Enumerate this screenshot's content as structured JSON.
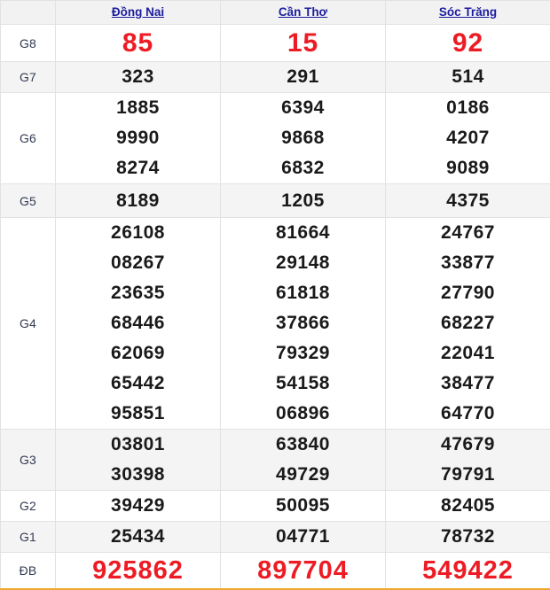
{
  "table": {
    "label_column_header": "",
    "provinces": [
      {
        "name": "Đồng Nai",
        "icon": "link-text"
      },
      {
        "name": "Cần Thơ",
        "icon": "link-text"
      },
      {
        "name": "Sóc Trăng",
        "icon": "link-text"
      }
    ],
    "colors": {
      "link": "#1c1ca0",
      "highlight_red": "#ed1b24",
      "number_black": "#1a1a1a",
      "row_shade": "#f4f4f4",
      "header_bg": "#f2f2f2",
      "border": "#e2e2e2",
      "bottom_accent": "#f0a62a"
    },
    "rows": [
      {
        "prize": "G8",
        "style": "red-big",
        "shaded": false,
        "cells": [
          [
            "85"
          ],
          [
            "15"
          ],
          [
            "92"
          ]
        ]
      },
      {
        "prize": "G7",
        "style": "normal",
        "shaded": true,
        "cells": [
          [
            "323"
          ],
          [
            "291"
          ],
          [
            "514"
          ]
        ]
      },
      {
        "prize": "G6",
        "style": "normal",
        "shaded": false,
        "cells": [
          [
            "1885",
            "9990",
            "8274"
          ],
          [
            "6394",
            "9868",
            "6832"
          ],
          [
            "0186",
            "4207",
            "9089"
          ]
        ]
      },
      {
        "prize": "G5",
        "style": "normal",
        "shaded": true,
        "cells": [
          [
            "8189"
          ],
          [
            "1205"
          ],
          [
            "4375"
          ]
        ]
      },
      {
        "prize": "G4",
        "style": "normal",
        "shaded": false,
        "cells": [
          [
            "26108",
            "08267",
            "23635",
            "68446",
            "62069",
            "65442",
            "95851"
          ],
          [
            "81664",
            "29148",
            "61818",
            "37866",
            "79329",
            "54158",
            "06896"
          ],
          [
            "24767",
            "33877",
            "27790",
            "68227",
            "22041",
            "38477",
            "64770"
          ]
        ]
      },
      {
        "prize": "G3",
        "style": "normal",
        "shaded": true,
        "cells": [
          [
            "03801",
            "30398"
          ],
          [
            "63840",
            "49729"
          ],
          [
            "47679",
            "79791"
          ]
        ]
      },
      {
        "prize": "G2",
        "style": "normal",
        "shaded": false,
        "cells": [
          [
            "39429"
          ],
          [
            "50095"
          ],
          [
            "82405"
          ]
        ]
      },
      {
        "prize": "G1",
        "style": "normal",
        "shaded": true,
        "cells": [
          [
            "25434"
          ],
          [
            "04771"
          ],
          [
            "78732"
          ]
        ]
      },
      {
        "prize": "ĐB",
        "style": "db",
        "shaded": false,
        "cells": [
          [
            "925862"
          ],
          [
            "897704"
          ],
          [
            "549422"
          ]
        ]
      }
    ]
  }
}
